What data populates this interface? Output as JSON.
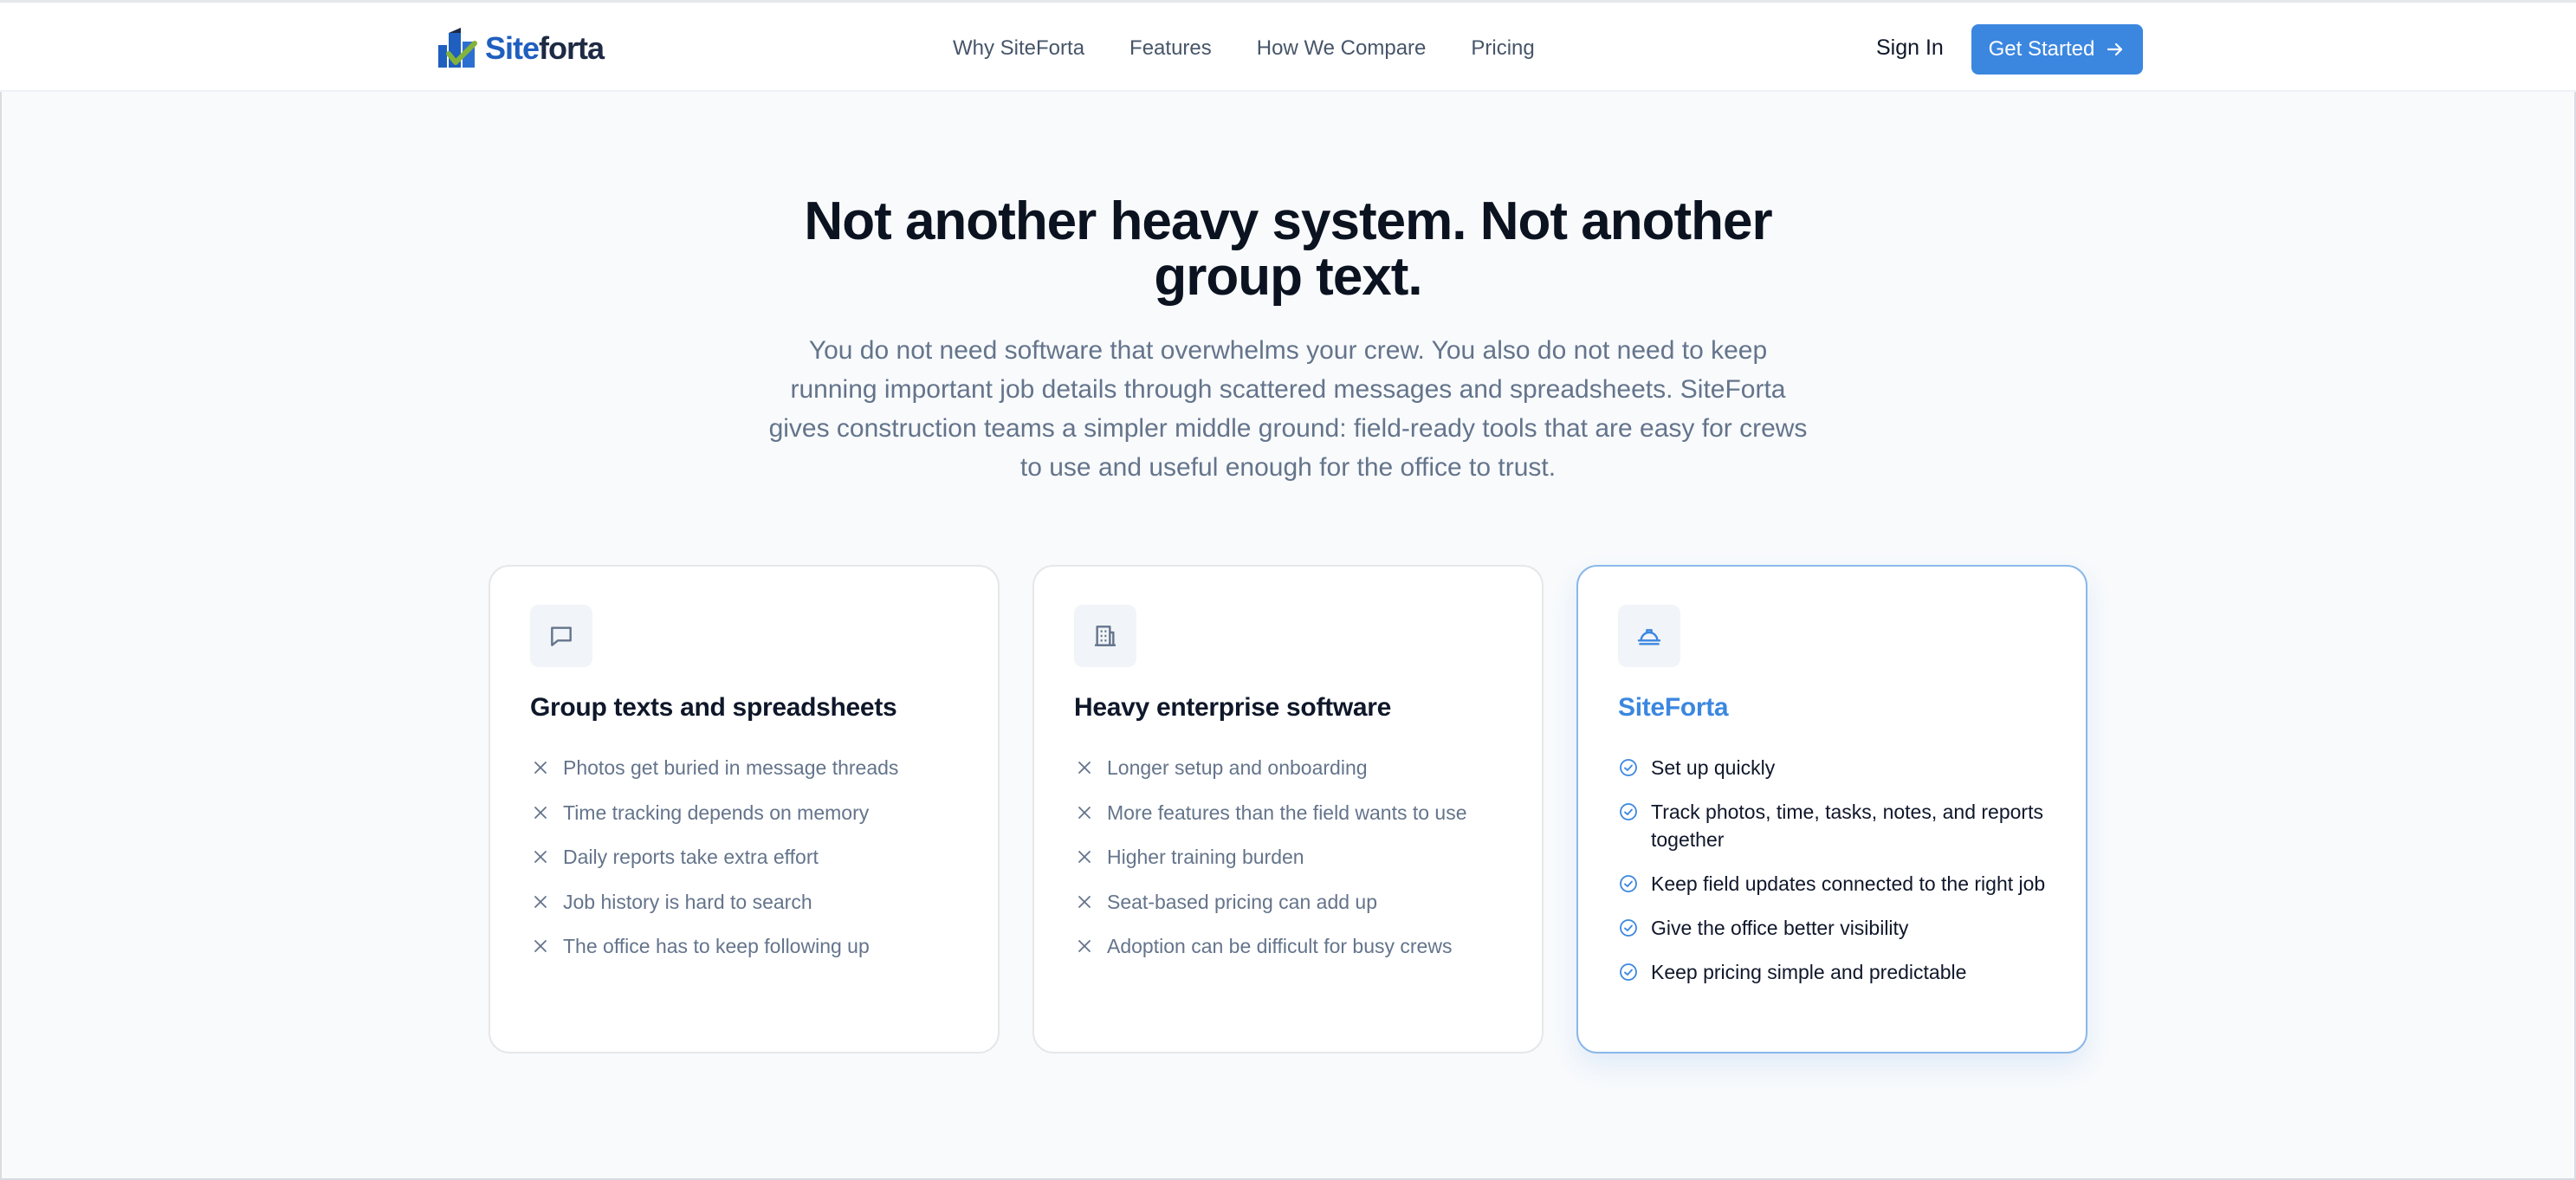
{
  "brand": {
    "name_part1": "Site",
    "name_part2": "forta",
    "color_primary": "#1f5fbf",
    "color_dark": "#1e2a44",
    "accent": "#3b87e0"
  },
  "nav": {
    "links": [
      "Why SiteForta",
      "Features",
      "How We Compare",
      "Pricing"
    ],
    "sign_in": "Sign In",
    "cta": "Get Started",
    "cta_icon": "arrow-right-icon"
  },
  "hero": {
    "title": "Not another heavy system. Not another group text.",
    "subtitle": "You do not need software that overwhelms your crew. You also do not need to keep running important job details through scattered messages and spreadsheets. SiteForta gives construction teams a simpler middle ground: field-ready tools that are easy for crews to use and useful enough for the office to trust."
  },
  "cards": [
    {
      "icon": "message-icon",
      "title": "Group texts and spreadsheets",
      "bullet_icon": "x-icon",
      "items": [
        "Photos get buried in message threads",
        "Time tracking depends on memory",
        "Daily reports take extra effort",
        "Job history is hard to search",
        "The office has to keep following up"
      ]
    },
    {
      "icon": "building-icon",
      "title": "Heavy enterprise software",
      "bullet_icon": "x-icon",
      "items": [
        "Longer setup and onboarding",
        "More features than the field wants to use",
        "Higher training burden",
        "Seat-based pricing can add up",
        "Adoption can be difficult for busy crews"
      ]
    },
    {
      "icon": "hard-hat-icon",
      "title": "SiteForta",
      "bullet_icon": "check-circle-icon",
      "items": [
        "Set up quickly",
        "Track photos, time, tasks, notes, and reports together",
        "Keep field updates connected to the right job",
        "Give the office better visibility",
        "Keep pricing simple and predictable"
      ]
    }
  ]
}
